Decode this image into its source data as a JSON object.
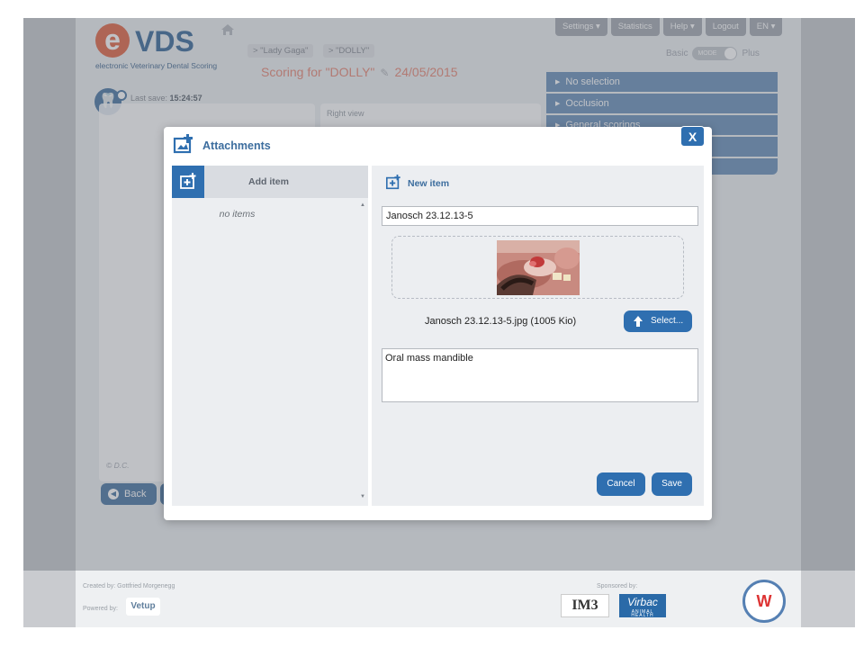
{
  "app": {
    "logo_mark": "e",
    "logo_text": "VDS",
    "logo_subtitle": "electronic Veterinary Dental Scoring"
  },
  "breadcrumb": [
    "> \"Lady Gaga\"",
    "> \"DOLLY\""
  ],
  "scoring": {
    "title": "Scoring for \"DOLLY\"",
    "date": "24/05/2015"
  },
  "topnav": [
    "Settings",
    "Statistics",
    "Help",
    "Logout",
    "EN"
  ],
  "mode": {
    "basic": "Basic",
    "toggle": "MODE",
    "plus": "Plus"
  },
  "last_save": {
    "label": "Last save:",
    "time": "15:24:57"
  },
  "right_view_label": "Right view",
  "copyright": "© D.C.",
  "back_label": "Back",
  "accordion": [
    "No selection",
    "Occlusion",
    "General scorings"
  ],
  "footer": {
    "created_by": "Created by: Gottfried Morgenegg",
    "powered_by": "Powered by:",
    "powered_logo": "Vetup",
    "sponsored_by": "Sponsored by:",
    "sponsor1": "IM3",
    "sponsor2": "Virbac",
    "sponsor2_sub": "ANIMAL HEALTH"
  },
  "modal": {
    "title": "Attachments",
    "close": "X",
    "add_item": "Add item",
    "no_items": "no items",
    "new_item": "New item",
    "name_value": "Janosch 23.12.13-5",
    "file_label": "Janosch 23.12.13-5.jpg (1005 Kio)",
    "select_label": "Select...",
    "description_value": "Oral mass mandible",
    "cancel_label": "Cancel",
    "save_label": "Save"
  },
  "colors": {
    "accent": "#2f6fb0",
    "title_blue": "#3c6d9e",
    "scoring_red": "#e88b7a",
    "panel_bg": "#eceef1"
  }
}
